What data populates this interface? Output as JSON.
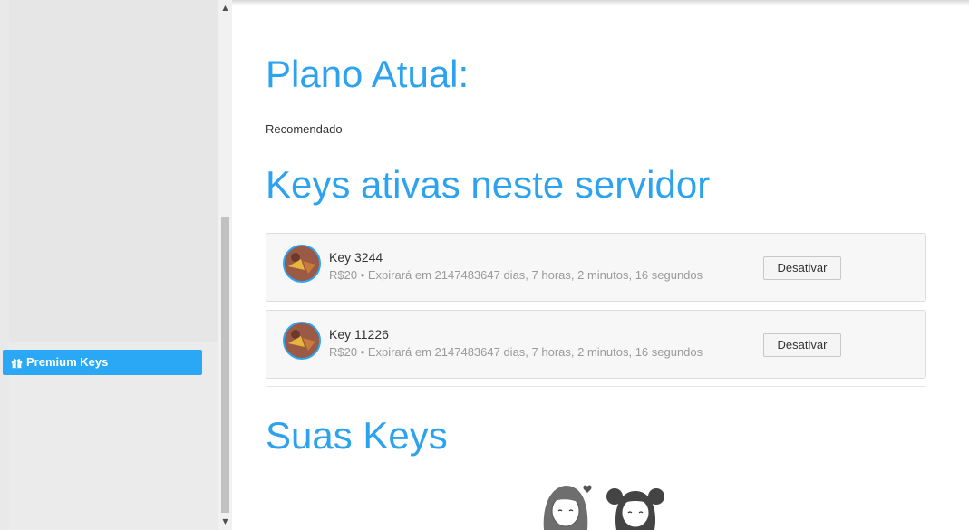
{
  "sidebar": {
    "premium_keys_label": "Premium Keys"
  },
  "main": {
    "current_plan_title": "Plano Atual:",
    "current_plan_value": "Recomendado",
    "active_keys_title": "Keys ativas neste servidor",
    "active_keys": [
      {
        "name": "Key 3244",
        "info": "R$20 • Expirará em 2147483647 dias, 7 horas, 2 minutos, 16 segundos",
        "button_label": "Desativar"
      },
      {
        "name": "Key 11226",
        "info": "R$20 • Expirará em 2147483647 dias, 7 horas, 2 minutos, 16 segundos",
        "button_label": "Desativar"
      }
    ],
    "your_keys_title": "Suas Keys"
  },
  "colors": {
    "accent": "#2da3ef",
    "button_primary": "#2aa7f5"
  },
  "icons": [
    "gift-icon",
    "scroll-up-icon",
    "scroll-down-icon"
  ]
}
